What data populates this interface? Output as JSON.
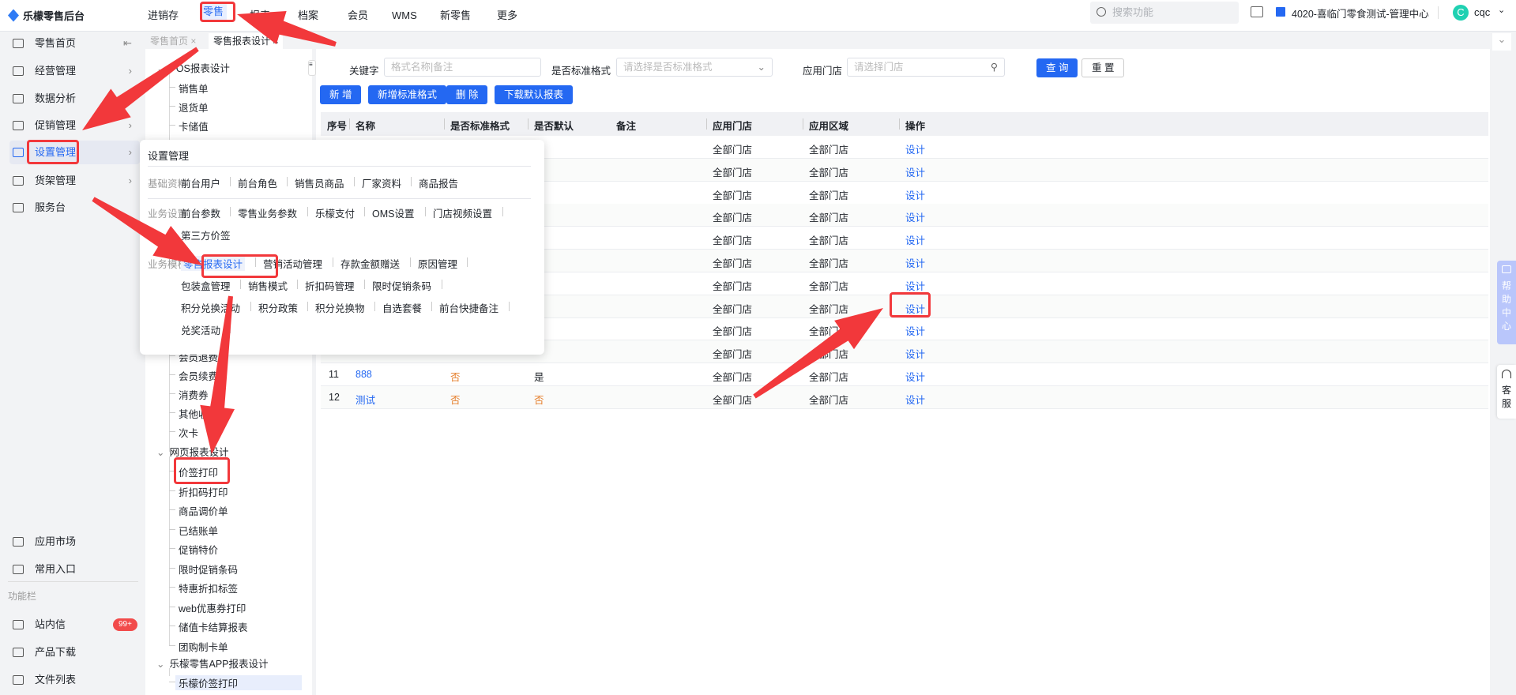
{
  "app": {
    "title": "乐檬零售后台"
  },
  "topnav": [
    "进销存",
    "零售",
    "报表",
    "档案",
    "会员",
    "WMS",
    "新零售",
    "更多"
  ],
  "header": {
    "search_placeholder": "搜索功能",
    "store": "4020-喜临门零食测试-管理中心",
    "user": "cqc",
    "avatar_letter": "C"
  },
  "sidebar": {
    "items": [
      "零售首页",
      "经营管理",
      "数据分析",
      "促销管理",
      "设置管理",
      "货架管理",
      "服务台"
    ],
    "bottom": [
      "应用市场",
      "常用入口"
    ],
    "section": "功能栏",
    "tools": [
      "站内信",
      "产品下载",
      "文件列表"
    ],
    "badge": "99+"
  },
  "tabs": [
    {
      "label": "零售首页"
    },
    {
      "label": "零售报表设计"
    }
  ],
  "tree": {
    "groups": [
      {
        "label": "POS报表设计",
        "items": [
          "销售单",
          "退货单",
          "卡储值"
        ]
      }
    ],
    "pos_more": [
      "会员退费",
      "会员续费",
      "消费券",
      "其他收",
      "次卡"
    ],
    "web": {
      "label": "网页报表设计",
      "items": [
        "价签打印",
        "折扣码打印",
        "商品调价单",
        "已结账单",
        "促销特价",
        "限时促销条码",
        "特惠折扣标签",
        "web优惠券打印",
        "储值卡结算报表",
        "团购制卡单"
      ]
    },
    "app": {
      "label": "乐檬零售APP报表设计",
      "items": [
        "乐檬价签打印"
      ]
    }
  },
  "filters": {
    "keyword_label": "关键字",
    "keyword_placeholder": "格式名称|备注",
    "standard_label": "是否标准格式",
    "standard_placeholder": "请选择是否标准格式",
    "store_label": "应用门店",
    "store_placeholder": "请选择门店",
    "query": "查 询",
    "reset": "重 置"
  },
  "actions": [
    "新 增",
    "新增标准格式",
    "删 除",
    "下载默认报表"
  ],
  "table": {
    "headers": [
      "序号",
      "名称",
      "是否标准格式",
      "是否默认",
      "备注",
      "应用门店",
      "应用区域",
      "操作"
    ],
    "rows": [
      [
        "",
        "",
        "",
        "",
        "",
        "全部门店",
        "全部门店",
        "设计"
      ],
      [
        "",
        "",
        "",
        "",
        "",
        "全部门店",
        "全部门店",
        "设计"
      ],
      [
        "",
        "",
        "",
        "",
        "",
        "全部门店",
        "全部门店",
        "设计"
      ],
      [
        "",
        "",
        "",
        "",
        "",
        "全部门店",
        "全部门店",
        "设计"
      ],
      [
        "",
        "",
        "",
        "",
        "",
        "全部门店",
        "全部门店",
        "设计"
      ],
      [
        "",
        "",
        "",
        "",
        "",
        "全部门店",
        "全部门店",
        "设计"
      ],
      [
        "",
        "",
        "",
        "",
        "",
        "全部门店",
        "全部门店",
        "设计"
      ],
      [
        "",
        "",
        "",
        "",
        "",
        "全部门店",
        "全部门店",
        "设计"
      ],
      [
        "",
        "",
        "",
        "",
        "",
        "全部门店",
        "全部门店",
        "设计"
      ],
      [
        "",
        "",
        "",
        "",
        "",
        "全部门店",
        "全部门店",
        "设计"
      ],
      [
        "11",
        "888",
        "否",
        "是",
        "",
        "全部门店",
        "全部门店",
        "设计"
      ],
      [
        "12",
        "测试",
        "否",
        "否",
        "",
        "全部门店",
        "全部门店",
        "设计"
      ]
    ]
  },
  "popup": {
    "title": "设置管理",
    "cats": [
      {
        "label": "基础资料",
        "lines": [
          [
            "前台用户",
            "前台角色",
            "销售员商品",
            "厂家资料",
            "商品报告"
          ]
        ]
      },
      {
        "label": "业务设置",
        "lines": [
          [
            "前台参数",
            "零售业务参数",
            "乐檬支付",
            "OMS设置",
            "门店视频设置"
          ],
          [
            "第三方价签"
          ]
        ]
      },
      {
        "label": "业务模板",
        "lines": [
          [
            "零售报表设计",
            "营销活动管理",
            "存款金额赠送",
            "原因管理"
          ],
          [
            "包装盒管理",
            "销售模式",
            "折扣码管理",
            "限时促销条码"
          ],
          [
            "积分兑换活动",
            "积分政策",
            "积分兑换物",
            "自选套餐",
            "前台快捷备注"
          ],
          [
            "兑奖活动"
          ]
        ]
      }
    ]
  },
  "float": {
    "help": "帮助中心",
    "service": "客服"
  },
  "colors": {
    "accent": "#2468f2",
    "annotation": "#f2383b"
  }
}
